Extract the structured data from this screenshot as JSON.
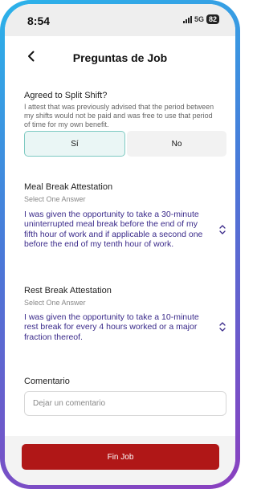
{
  "status_bar": {
    "time": "8:54",
    "network": "5G",
    "battery": "82"
  },
  "header": {
    "back_icon": "chevron-left-icon",
    "title": "Preguntas de Job"
  },
  "split_shift": {
    "title": "Agreed to Split Shift?",
    "description": "I attest that was previously advised that the period between my shifts would not be paid and was free to use that period of time for my own benefit.",
    "yes_label": "Sí",
    "no_label": "No",
    "selected": "Sí"
  },
  "meal_break": {
    "title": "Meal Break Attestation",
    "subtitle": "Select One Answer",
    "selected_answer": "I was given the opportunity to take a 30-minute uninterrupted meal break before the end of my fifth hour of work and if applicable a second one before the end of my tenth hour of work.",
    "icon": "chevron-up-down-icon"
  },
  "rest_break": {
    "title": "Rest Break Attestation",
    "subtitle": "Select One Answer",
    "selected_answer": "I was given the opportunity to take a 10-minute rest break for every 4 hours worked or a major fraction thereof.",
    "icon": "chevron-up-down-icon"
  },
  "comment": {
    "label": "Comentario",
    "placeholder": "Dejar un comentario",
    "value": ""
  },
  "footer": {
    "button_label": "Fin Job"
  },
  "colors": {
    "accent_red": "#b01717",
    "selected_teal": "#7ecac2",
    "answer_text": "#3a2a8a"
  }
}
